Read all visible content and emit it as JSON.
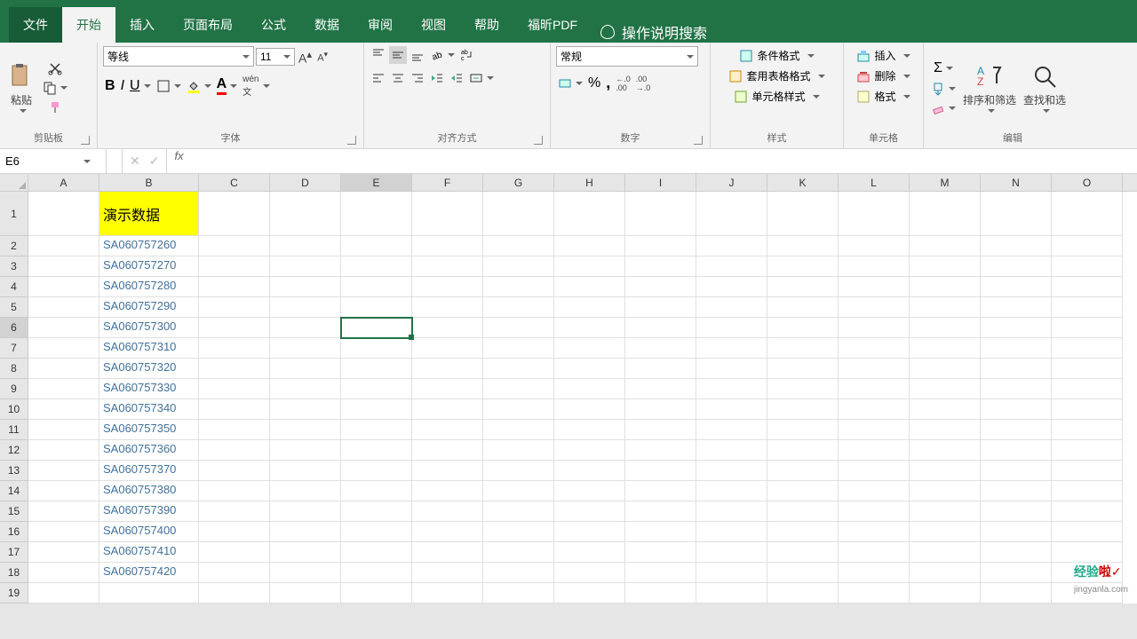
{
  "tabs": {
    "file": "文件",
    "home": "开始",
    "insert": "插入",
    "layout": "页面布局",
    "formulas": "公式",
    "data": "数据",
    "review": "审阅",
    "view": "视图",
    "help": "帮助",
    "foxit": "福昕PDF",
    "search": "操作说明搜索"
  },
  "ribbon": {
    "clipboard": {
      "paste": "粘贴",
      "label": "剪贴板"
    },
    "font": {
      "name": "等线",
      "size": "11",
      "label": "字体"
    },
    "align": {
      "label": "对齐方式"
    },
    "number": {
      "format": "常规",
      "label": "数字"
    },
    "styles": {
      "cond": "条件格式",
      "table": "套用表格格式",
      "cell": "单元格样式",
      "label": "样式"
    },
    "cells": {
      "insert": "插入",
      "delete": "删除",
      "format": "格式",
      "label": "单元格"
    },
    "editing": {
      "sort": "排序和筛选",
      "find": "查找和选",
      "label": "编辑"
    }
  },
  "namebox": "E6",
  "formula": "",
  "columns": [
    "A",
    "B",
    "C",
    "D",
    "E",
    "F",
    "G",
    "H",
    "I",
    "J",
    "K",
    "L",
    "M",
    "N",
    "O"
  ],
  "selectedColIndex": 4,
  "selectedRowIndex": 5,
  "data": {
    "B1": "演示数据",
    "rows": [
      "SA060757260",
      "SA060757270",
      "SA060757280",
      "SA060757290",
      "SA060757300",
      "SA060757310",
      "SA060757320",
      "SA060757330",
      "SA060757340",
      "SA060757350",
      "SA060757360",
      "SA060757370",
      "SA060757380",
      "SA060757390",
      "SA060757400",
      "SA060757410",
      "SA060757420"
    ]
  },
  "watermark": {
    "brand1": "经验",
    "brand2": "啦",
    "url": "jingyanla.com"
  },
  "chart_data": null
}
